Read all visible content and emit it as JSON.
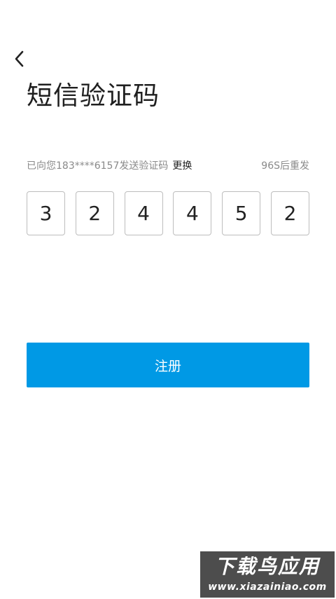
{
  "header": {
    "back_icon": "chevron-left-icon",
    "title": "短信验证码"
  },
  "info": {
    "sent_message": "已向您183****6157发送验证码",
    "change_label": "更换",
    "resend_timer": "96S后重发"
  },
  "code": {
    "digits": [
      "3",
      "2",
      "4",
      "4",
      "5",
      "2"
    ]
  },
  "actions": {
    "register_label": "注册"
  },
  "colors": {
    "accent": "#0099e5",
    "muted_text": "#8a8a8a",
    "box_border": "#bdbdbd"
  },
  "watermark": {
    "main": "下载鸟应用",
    "sub": "www.xiazainiao.com"
  }
}
